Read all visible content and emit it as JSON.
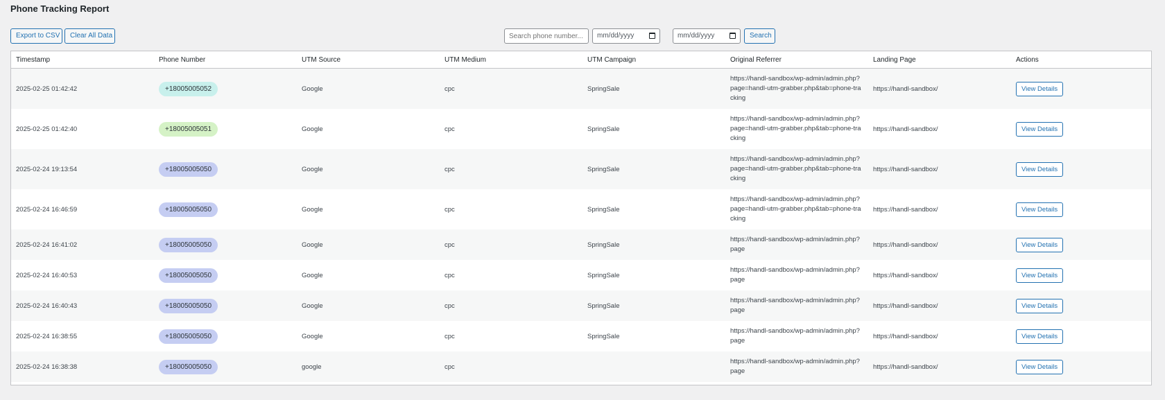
{
  "page": {
    "title": "Phone Tracking Report"
  },
  "toolbar": {
    "export_label": "Export to CSV",
    "clear_label": "Clear All Data",
    "search_placeholder": "Search phone number...",
    "date_from_placeholder": "mm/dd/yyyy",
    "date_to_placeholder": "mm/dd/yyyy",
    "search_label": "Search"
  },
  "table": {
    "headers": [
      "Timestamp",
      "Phone Number",
      "UTM Source",
      "UTM Medium",
      "UTM Campaign",
      "Original Referrer",
      "Landing Page",
      "Actions"
    ],
    "rows": [
      {
        "timestamp": "2025-02-25 01:42:42",
        "phone": "+18005005052",
        "pill_color": "#c8f0ec",
        "source": "Google",
        "medium": "cpc",
        "campaign": "SpringSale",
        "referrer": "https://handl-sandbox/wp-admin/admin.php?page=handl-utm-grabber.php&tab=phone-tracking",
        "landing": "https://handl-sandbox/",
        "action": "View Details"
      },
      {
        "timestamp": "2025-02-25 01:42:40",
        "phone": "+18005005051",
        "pill_color": "#d5f2c6",
        "source": "Google",
        "medium": "cpc",
        "campaign": "SpringSale",
        "referrer": "https://handl-sandbox/wp-admin/admin.php?page=handl-utm-grabber.php&tab=phone-tracking",
        "landing": "https://handl-sandbox/",
        "action": "View Details"
      },
      {
        "timestamp": "2025-02-24 19:13:54",
        "phone": "+18005005050",
        "pill_color": "#c5cdf2",
        "source": "Google",
        "medium": "cpc",
        "campaign": "SpringSale",
        "referrer": "https://handl-sandbox/wp-admin/admin.php?page=handl-utm-grabber.php&tab=phone-tracking",
        "landing": "https://handl-sandbox/",
        "action": "View Details"
      },
      {
        "timestamp": "2025-02-24 16:46:59",
        "phone": "+18005005050",
        "pill_color": "#c5cdf2",
        "source": "Google",
        "medium": "cpc",
        "campaign": "SpringSale",
        "referrer": "https://handl-sandbox/wp-admin/admin.php?page=handl-utm-grabber.php&tab=phone-tracking",
        "landing": "https://handl-sandbox/",
        "action": "View Details"
      },
      {
        "timestamp": "2025-02-24 16:41:02",
        "phone": "+18005005050",
        "pill_color": "#c5cdf2",
        "source": "Google",
        "medium": "cpc",
        "campaign": "SpringSale",
        "referrer": "https://handl-sandbox/wp-admin/admin.php?page",
        "landing": "https://handl-sandbox/",
        "action": "View Details"
      },
      {
        "timestamp": "2025-02-24 16:40:53",
        "phone": "+18005005050",
        "pill_color": "#c5cdf2",
        "source": "Google",
        "medium": "cpc",
        "campaign": "SpringSale",
        "referrer": "https://handl-sandbox/wp-admin/admin.php?page",
        "landing": "https://handl-sandbox/",
        "action": "View Details"
      },
      {
        "timestamp": "2025-02-24 16:40:43",
        "phone": "+18005005050",
        "pill_color": "#c5cdf2",
        "source": "Google",
        "medium": "cpc",
        "campaign": "SpringSale",
        "referrer": "https://handl-sandbox/wp-admin/admin.php?page",
        "landing": "https://handl-sandbox/",
        "action": "View Details"
      },
      {
        "timestamp": "2025-02-24 16:38:55",
        "phone": "+18005005050",
        "pill_color": "#c5cdf2",
        "source": "Google",
        "medium": "cpc",
        "campaign": "SpringSale",
        "referrer": "https://handl-sandbox/wp-admin/admin.php?page",
        "landing": "https://handl-sandbox/",
        "action": "View Details"
      },
      {
        "timestamp": "2025-02-24 16:38:38",
        "phone": "+18005005050",
        "pill_color": "#c5cdf2",
        "source": "google",
        "medium": "cpc",
        "campaign": "",
        "referrer": "https://handl-sandbox/wp-admin/admin.php?page",
        "landing": "https://handl-sandbox/",
        "action": "View Details"
      }
    ]
  },
  "colors": {
    "accent": "#2271b1",
    "background": "#f0f0f1"
  }
}
